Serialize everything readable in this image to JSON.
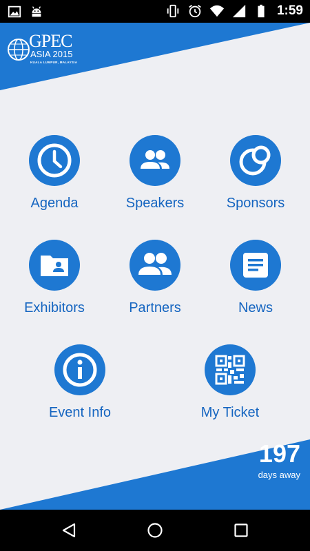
{
  "status_bar": {
    "time": "1:59",
    "icons": [
      "image-icon",
      "android-icon",
      "vibrate-icon",
      "alarm-icon",
      "wifi-icon",
      "signal-icon",
      "battery-icon"
    ]
  },
  "brand": {
    "logo_word": "GPEC",
    "logo_year": "ASIA 2015",
    "logo_place": "KUALA LUMPUR, MALAYSIA",
    "accent_color": "#1e78d2"
  },
  "menu": [
    {
      "label": "Agenda",
      "icon": "clock-icon"
    },
    {
      "label": "Speakers",
      "icon": "people-icon"
    },
    {
      "label": "Sponsors",
      "icon": "sponsors-icon"
    },
    {
      "label": "Exhibitors",
      "icon": "folder-user-icon"
    },
    {
      "label": "Partners",
      "icon": "people-icon"
    },
    {
      "label": "News",
      "icon": "news-icon"
    },
    {
      "label": "Event Info",
      "icon": "info-icon"
    },
    {
      "label": "My Ticket",
      "icon": "qr-code-icon"
    }
  ],
  "countdown": {
    "value": "197",
    "unit": "days away"
  },
  "nav_bar": {
    "icons": [
      "back-icon",
      "home-icon",
      "recents-icon"
    ]
  }
}
